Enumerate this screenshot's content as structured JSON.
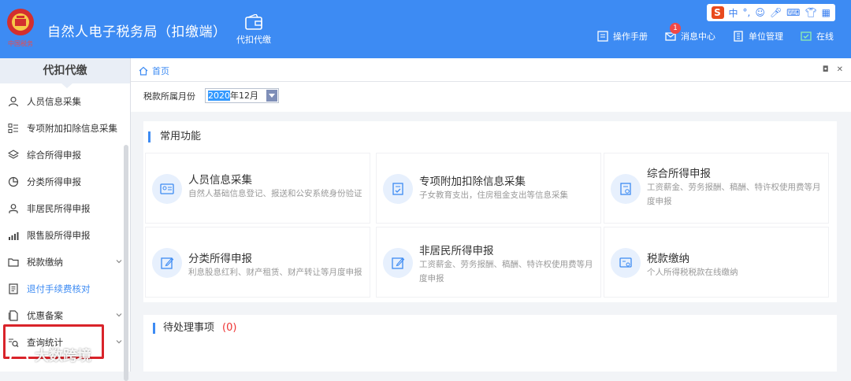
{
  "header": {
    "app_title": "自然人电子税务局（扣缴端）",
    "nav_main_label": "代扣代缴",
    "links": [
      {
        "label": "操作手册",
        "icon": "manual-icon"
      },
      {
        "label": "消息中心",
        "icon": "mail-icon",
        "badge": "1"
      },
      {
        "label": "单位管理",
        "icon": "building-icon"
      },
      {
        "label": "在线",
        "icon": "online-icon"
      }
    ],
    "ime": {
      "logo": "S",
      "lang": "中",
      "punct": "°,"
    }
  },
  "sidebar": {
    "title": "代扣代缴",
    "items": [
      {
        "label": "人员信息采集",
        "icon": "person-icon"
      },
      {
        "label": "专项附加扣除信息采集",
        "icon": "list-icon"
      },
      {
        "label": "综合所得申报",
        "icon": "layers-icon"
      },
      {
        "label": "分类所得申报",
        "icon": "pie-icon"
      },
      {
        "label": "非居民所得申报",
        "icon": "person-outline-icon"
      },
      {
        "label": "限售股所得申报",
        "icon": "bar-chart-icon"
      },
      {
        "label": "税款缴纳",
        "icon": "folder-icon"
      },
      {
        "label": "退付手续费核对",
        "icon": "doc-icon"
      },
      {
        "label": "优惠备案",
        "icon": "file-icon"
      },
      {
        "label": "查询统计",
        "icon": "search-list-icon"
      }
    ]
  },
  "tabs": {
    "home": "首页"
  },
  "period": {
    "label": "税款所属月份",
    "value_selected": "2020",
    "value_rest": "年12月"
  },
  "common": {
    "title": "常用功能",
    "cards": [
      {
        "title": "人员信息采集",
        "desc": "自然人基础信息登记、报送和公安系统身份验证",
        "icon": "id-card-icon"
      },
      {
        "title": "专项附加扣除信息采集",
        "desc": "子女教育支出，住房租金支出等信息采集",
        "icon": "doc-check-icon"
      },
      {
        "title": "综合所得申报",
        "desc": "工资薪金、劳务报酬、稿酬、特许权使用费等月度申报",
        "icon": "report-icon"
      },
      {
        "title": "分类所得申报",
        "desc": "利息股息红利、财产租赁、财产转让等月度申报",
        "icon": "edit-icon"
      },
      {
        "title": "非居民所得申报",
        "desc": "工资薪金、劳务报酬、稿酬、特许权使用费等月度申报",
        "icon": "edit-icon"
      },
      {
        "title": "税款缴纳",
        "desc": "个人所得税税款在线缴纳",
        "icon": "payment-icon"
      }
    ]
  },
  "pending": {
    "title": "待处理事项",
    "count": "(0)"
  },
  "watermark": "大数跨境"
}
